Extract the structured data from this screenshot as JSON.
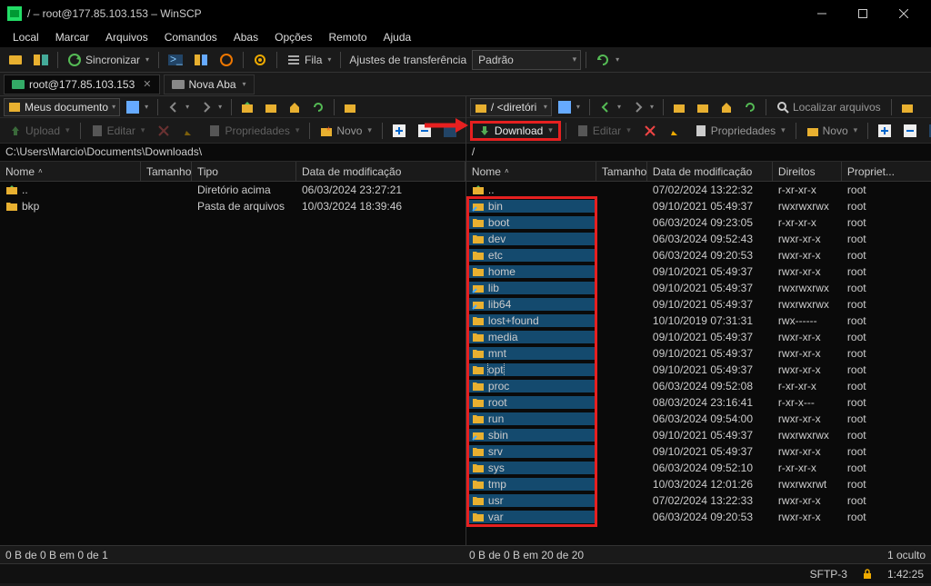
{
  "window": {
    "title": "/ – root@177.85.103.153 – WinSCP"
  },
  "menu": [
    "Local",
    "Marcar",
    "Arquivos",
    "Comandos",
    "Abas",
    "Opções",
    "Remoto",
    "Ajuda"
  ],
  "toolbar": {
    "sync": "Sincronizar",
    "queue": "Fila",
    "transfer_label": "Ajustes de transferência",
    "transfer_preset": "Padrão"
  },
  "tabs": {
    "session": "root@177.85.103.153",
    "newtab": "Nova Aba"
  },
  "local": {
    "bookmark": "Meus documento",
    "actions": {
      "upload": "Upload",
      "edit": "Editar",
      "props": "Propriedades",
      "new": "Novo"
    },
    "path": "C:\\Users\\Marcio\\Documents\\Downloads\\",
    "cols": {
      "name": "Nome",
      "size": "Tamanho",
      "type": "Tipo",
      "mod": "Data de modificação"
    },
    "rows": [
      {
        "name": "..",
        "type": "Diretório acima",
        "mod": "06/03/2024 23:27:21",
        "up": true
      },
      {
        "name": "bkp",
        "type": "Pasta de arquivos",
        "mod": "10/03/2024 18:39:46"
      }
    ],
    "status": "0 B de 0 B em 0 de 1"
  },
  "remote": {
    "bookmark": "/ <diretóri",
    "find": "Localizar arquivos",
    "actions": {
      "download": "Download",
      "edit": "Editar",
      "props": "Propriedades",
      "new": "Novo"
    },
    "cols": {
      "name": "Nome",
      "size": "Tamanho",
      "mod": "Data de modificação",
      "rights": "Direitos",
      "owner": "Propriet..."
    },
    "rows": [
      {
        "name": "..",
        "mod": "07/02/2024 13:22:32",
        "rights": "r-xr-xr-x",
        "owner": "root",
        "up": true
      },
      {
        "name": "bin",
        "mod": "09/10/2021 05:49:37",
        "rights": "rwxrwxrwx",
        "owner": "root",
        "link": true
      },
      {
        "name": "boot",
        "mod": "06/03/2024 09:23:05",
        "rights": "r-xr-xr-x",
        "owner": "root"
      },
      {
        "name": "dev",
        "mod": "06/03/2024 09:52:43",
        "rights": "rwxr-xr-x",
        "owner": "root"
      },
      {
        "name": "etc",
        "mod": "06/03/2024 09:20:53",
        "rights": "rwxr-xr-x",
        "owner": "root"
      },
      {
        "name": "home",
        "mod": "09/10/2021 05:49:37",
        "rights": "rwxr-xr-x",
        "owner": "root"
      },
      {
        "name": "lib",
        "mod": "09/10/2021 05:49:37",
        "rights": "rwxrwxrwx",
        "owner": "root",
        "link": true
      },
      {
        "name": "lib64",
        "mod": "09/10/2021 05:49:37",
        "rights": "rwxrwxrwx",
        "owner": "root",
        "link": true
      },
      {
        "name": "lost+found",
        "mod": "10/10/2019 07:31:31",
        "rights": "rwx------",
        "owner": "root"
      },
      {
        "name": "media",
        "mod": "09/10/2021 05:49:37",
        "rights": "rwxr-xr-x",
        "owner": "root"
      },
      {
        "name": "mnt",
        "mod": "09/10/2021 05:49:37",
        "rights": "rwxr-xr-x",
        "owner": "root"
      },
      {
        "name": "opt",
        "mod": "09/10/2021 05:49:37",
        "rights": "rwxr-xr-x",
        "owner": "root",
        "sel": true
      },
      {
        "name": "proc",
        "mod": "06/03/2024 09:52:08",
        "rights": "r-xr-xr-x",
        "owner": "root"
      },
      {
        "name": "root",
        "mod": "08/03/2024 23:16:41",
        "rights": "r-xr-x---",
        "owner": "root"
      },
      {
        "name": "run",
        "mod": "06/03/2024 09:54:00",
        "rights": "rwxr-xr-x",
        "owner": "root"
      },
      {
        "name": "sbin",
        "mod": "09/10/2021 05:49:37",
        "rights": "rwxrwxrwx",
        "owner": "root",
        "link": true
      },
      {
        "name": "srv",
        "mod": "09/10/2021 05:49:37",
        "rights": "rwxr-xr-x",
        "owner": "root"
      },
      {
        "name": "sys",
        "mod": "06/03/2024 09:52:10",
        "rights": "r-xr-xr-x",
        "owner": "root"
      },
      {
        "name": "tmp",
        "mod": "10/03/2024 12:01:26",
        "rights": "rwxrwxrwt",
        "owner": "root"
      },
      {
        "name": "usr",
        "mod": "07/02/2024 13:22:33",
        "rights": "rwxr-xr-x",
        "owner": "root"
      },
      {
        "name": "var",
        "mod": "06/03/2024 09:20:53",
        "rights": "rwxr-xr-x",
        "owner": "root"
      }
    ],
    "status": "0 B de 0 B em 20 de 20",
    "hidden": "1 oculto"
  },
  "footer": {
    "proto": "SFTP-3",
    "time": "1:42:25"
  }
}
